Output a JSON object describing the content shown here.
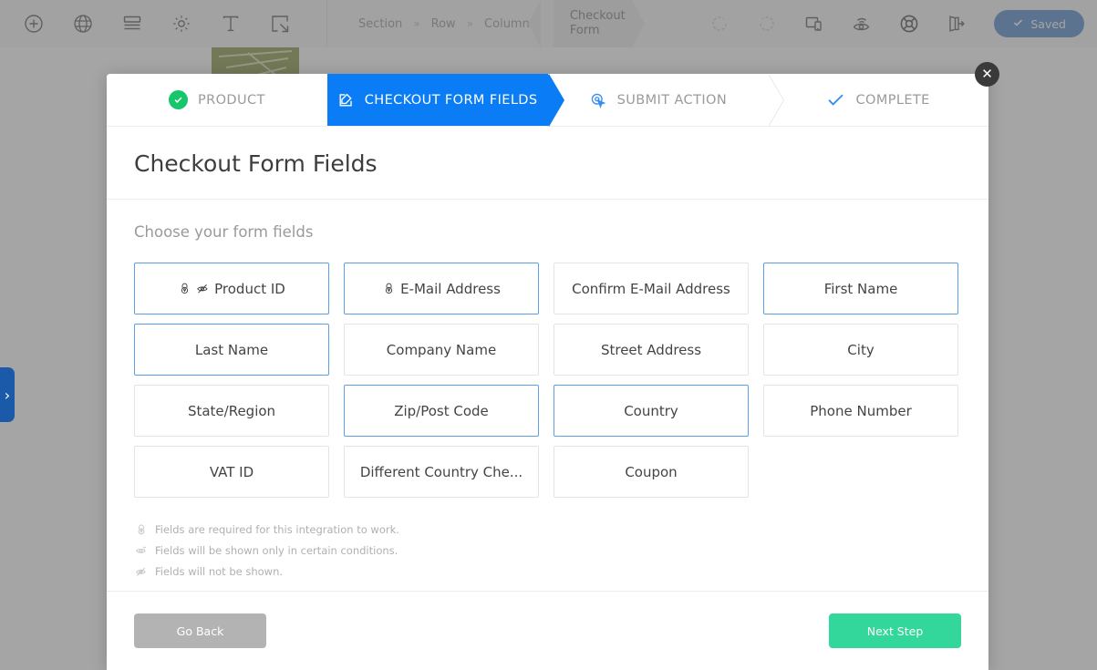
{
  "toolbar": {
    "left_icons": [
      {
        "name": "add-icon",
        "glyph": "plus-circle"
      },
      {
        "name": "globe-icon",
        "glyph": "globe"
      },
      {
        "name": "layout-icon",
        "glyph": "rows"
      },
      {
        "name": "settings-gear-icon",
        "glyph": "gear"
      },
      {
        "name": "text-tool-icon",
        "glyph": "serif-T"
      },
      {
        "name": "resize-region-icon",
        "glyph": "frame-arrow"
      }
    ],
    "breadcrumb": {
      "items": [
        "Section",
        "Row",
        "Column"
      ],
      "separator": "»",
      "active": "Checkout Form"
    },
    "right_icons": [
      {
        "name": "undo-icon",
        "glyph": "undo"
      },
      {
        "name": "redo-icon",
        "glyph": "redo"
      },
      {
        "name": "responsive-preview-icon",
        "glyph": "devices"
      },
      {
        "name": "preview-eye-icon",
        "glyph": "eye-wifi"
      },
      {
        "name": "help-lifebuoy-icon",
        "glyph": "lifebuoy"
      },
      {
        "name": "exit-builder-icon",
        "glyph": "exit-door"
      }
    ],
    "saved_label": "Saved",
    "saved_color": "#3f7bc4"
  },
  "edge_tab": {
    "name": "panel-expand-tab",
    "glyph": "›",
    "color": "#1a5aa8"
  },
  "modal": {
    "close_label": "✕",
    "title": "Checkout Form Fields",
    "steps": [
      {
        "label": "PRODUCT",
        "icon": "check-circle-icon",
        "state": "complete"
      },
      {
        "label": "CHECKOUT FORM FIELDS",
        "icon": "edit-square-icon",
        "state": "active"
      },
      {
        "label": "SUBMIT ACTION",
        "icon": "click-target-icon",
        "state": "upcoming"
      },
      {
        "label": "COMPLETE",
        "icon": "check-icon",
        "state": "upcoming"
      }
    ],
    "active_color": "#0a7cf5",
    "complete_color": "#16c66b",
    "body": {
      "choose_label": "Choose your form fields",
      "fields": [
        {
          "label": "Product ID",
          "selected": true,
          "icons": [
            "lock-icon",
            "eye-slash-icon"
          ]
        },
        {
          "label": "E-Mail Address",
          "selected": true,
          "icons": [
            "lock-icon"
          ]
        },
        {
          "label": "Confirm E-Mail Address",
          "selected": false,
          "icons": []
        },
        {
          "label": "First Name",
          "selected": true,
          "icons": []
        },
        {
          "label": "Last Name",
          "selected": true,
          "icons": []
        },
        {
          "label": "Company Name",
          "selected": false,
          "icons": []
        },
        {
          "label": "Street Address",
          "selected": false,
          "icons": []
        },
        {
          "label": "City",
          "selected": false,
          "icons": []
        },
        {
          "label": "State/Region",
          "selected": false,
          "icons": []
        },
        {
          "label": "Zip/Post Code",
          "selected": true,
          "icons": []
        },
        {
          "label": "Country",
          "selected": true,
          "icons": []
        },
        {
          "label": "Phone Number",
          "selected": false,
          "icons": []
        },
        {
          "label": "VAT ID",
          "selected": false,
          "icons": []
        },
        {
          "label": "Different Country Che...",
          "selected": false,
          "icons": []
        },
        {
          "label": "Coupon",
          "selected": false,
          "icons": []
        }
      ],
      "selected_border_color": "#5b9fe8",
      "legend": [
        {
          "icon": "lock-icon",
          "text": "Fields are required for this integration to work."
        },
        {
          "icon": "eye-icon",
          "text": "Fields will be shown only in certain conditions."
        },
        {
          "icon": "eye-slash-icon",
          "text": "Fields will not be shown."
        }
      ]
    },
    "footer": {
      "back_label": "Go Back",
      "back_color": "#b3b3b3",
      "next_label": "Next Step",
      "next_color": "#33d69b"
    }
  }
}
